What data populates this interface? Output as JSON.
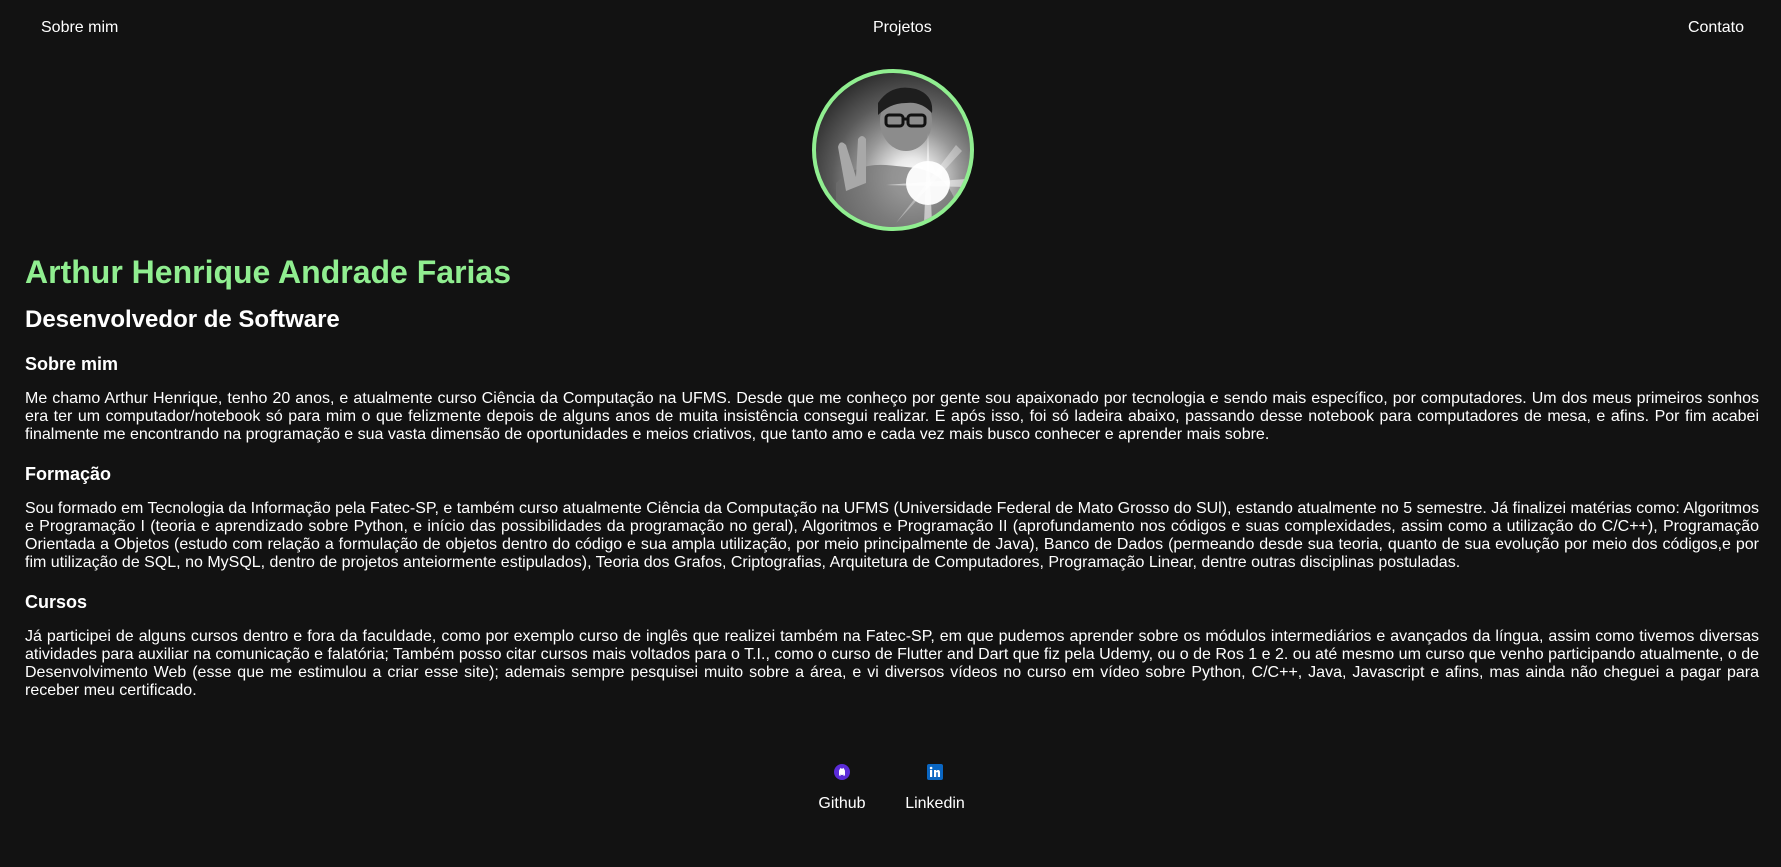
{
  "nav": {
    "about": "Sobre mim",
    "projects": "Projetos",
    "contact": "Contato"
  },
  "profile": {
    "name": "Arthur Henrique Andrade Farias",
    "role": "Desenvolvedor de Software",
    "avatar_icon": "profile-photo"
  },
  "sections": [
    {
      "title": "Sobre mim",
      "text": "Me chamo Arthur Henrique, tenho 20 anos, e atualmente curso Ciência da Computação na UFMS. Desde que me conheço por gente sou apaixonado por tecnologia e sendo mais específico, por computadores. Um dos meus primeiros sonhos era ter um computador/notebook só para mim o que felizmente depois de alguns anos de muita insistência consegui realizar. E após isso, foi só ladeira abaixo, passando desse notebook para computadores de mesa, e afins. Por fim acabei finalmente me encontrando na programação e sua vasta dimensão de oportunidades e meios criativos, que tanto amo e cada vez mais busco conhecer e aprender mais sobre."
    },
    {
      "title": "Formação",
      "text": "Sou formado em Tecnologia da Informação pela Fatec-SP, e também curso atualmente Ciência da Computação na UFMS (Universidade Federal de Mato Grosso do SUl), estando atualmente no 5 semestre. Já finalizei matérias como: Algoritmos e Programação I (teoria e aprendizado sobre Python, e início das possibilidades da programação no geral), Algoritmos e Programação II (aprofundamento nos códigos e suas complexidades, assim como a utilização do C/C++), Programação Orientada a Objetos (estudo com relação a formulação de objetos dentro do código e sua ampla utilização, por meio principalmente de Java), Banco de Dados (permeando desde sua teoria, quanto de sua evolução por meio dos códigos,e por fim utilização de SQL, no MySQL, dentro de projetos anteiormente estipulados), Teoria dos Grafos, Criptografias, Arquitetura de Computadores, Programação Linear, dentre outras disciplinas postuladas."
    },
    {
      "title": "Cursos",
      "text": "Já participei de alguns cursos dentro e fora da faculdade, como por exemplo curso de inglês que realizei também na Fatec-SP, em que pudemos aprender sobre os módulos intermediários e avançados da língua, assim como tivemos diversas atividades para auxiliar na comunicação e falatória; Também posso citar cursos mais voltados para o T.I., como o curso de Flutter and Dart que fiz pela Udemy, ou o de Ros 1 e 2. ou até mesmo um curso que venho participando atualmente, o de Desenvolvimento Web (esse que me estimulou a criar esse site); ademais sempre pesquisei muito sobre a área, e vi diversos vídeos no curso em vídeo sobre Python, C/C++, Java, Javascript e afins, mas ainda não cheguei a pagar para receber meu certificado."
    }
  ],
  "socials": {
    "github": {
      "label": "Github",
      "icon": "github-icon",
      "color": "#5b2bd8"
    },
    "linkedin": {
      "label": "Linkedin",
      "icon": "linkedin-icon",
      "color": "#0a66c2"
    }
  },
  "colors": {
    "background": "#121212",
    "accent": "#90ee90",
    "text": "#ffffff"
  }
}
